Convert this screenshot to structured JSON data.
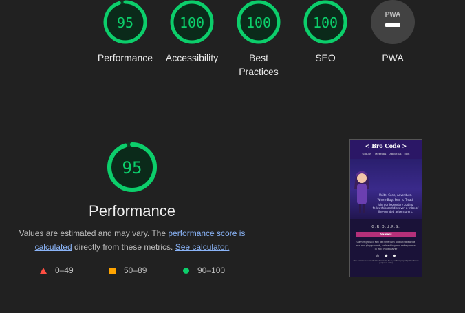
{
  "colors": {
    "pass": "#0cce6b",
    "average": "#ffa400",
    "fail": "#ff4e42",
    "na": "#9e9e9e",
    "background": "#212121"
  },
  "gauges": [
    {
      "label": "Performance",
      "score": "95",
      "value": 95
    },
    {
      "label": "Accessibility",
      "score": "100",
      "value": 100
    },
    {
      "label": "Best Practices",
      "score": "100",
      "value": 100
    },
    {
      "label": "SEO",
      "score": "100",
      "value": 100
    },
    {
      "label": "PWA",
      "score": "PWA",
      "value": null
    }
  ],
  "performance": {
    "score": "95",
    "value": 95,
    "title": "Performance",
    "desc_prefix": "Values are estimated and may vary. The ",
    "link_score": "performance score is calculated",
    "desc_middle": " directly from these metrics. ",
    "link_calc": "See calculator."
  },
  "legend": [
    {
      "range": "0–49",
      "icon": "triangle-icon"
    },
    {
      "range": "50–89",
      "icon": "square-icon"
    },
    {
      "range": "90–100",
      "icon": "circle-icon"
    }
  ],
  "thumbnail": {
    "brand": "< Bro Code >",
    "nav": [
      "Groups",
      "Meetups",
      "About Us",
      "Join"
    ],
    "tagline": [
      "Unite, Code, Adventure.",
      "Where Bugs Fear to Tread!",
      "Join our legendary coding fellowship and discover a tribe of like-minded adventurers."
    ],
    "groups": "G.R.O.U.P.S.",
    "gamers": "Gamers",
    "body": "Gamer group? You bet! We turn pixelated worlds into our playgrounds, unleashing our coda powers in epic multiplayer",
    "footer": "This website was created by Bro Code for a portfolio project (educational purposes only)"
  }
}
